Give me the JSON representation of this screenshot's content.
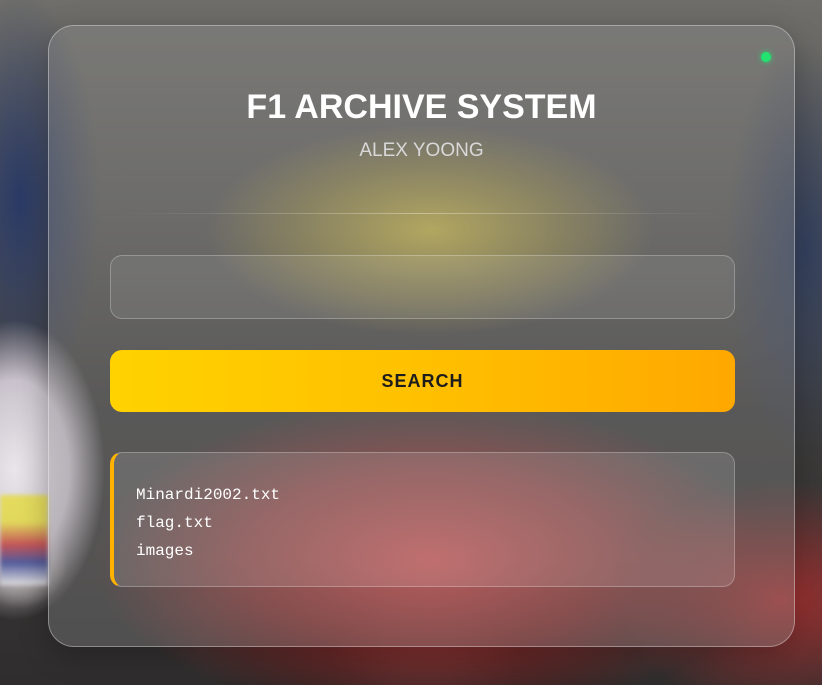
{
  "app": {
    "title": "F1 ARCHIVE SYSTEM",
    "subtitle": "ALEX YOONG",
    "status_indicator_color": "#22e36f"
  },
  "search": {
    "value": "",
    "placeholder": "",
    "button_label": "SEARCH",
    "button_gradient": [
      "#ffd200",
      "#ffa800"
    ]
  },
  "results": {
    "accent_color": "#ffb300",
    "items": [
      "Minardi2002.txt",
      "flag.txt",
      "images"
    ]
  }
}
